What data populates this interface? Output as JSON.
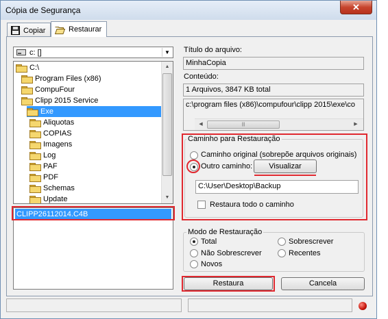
{
  "window": {
    "title": "Cópia de Segurança",
    "close_label": "✕"
  },
  "tabs": [
    {
      "label": "Copiar"
    },
    {
      "label": "Restaurar"
    }
  ],
  "drive": {
    "value": "c: []"
  },
  "tree": {
    "items": [
      {
        "label": "C:\\"
      },
      {
        "label": "Program Files (x86)"
      },
      {
        "label": "CompuFour"
      },
      {
        "label": "Clipp 2015 Service"
      },
      {
        "label": "Exe"
      },
      {
        "label": "Aliquotas"
      },
      {
        "label": "COPIAS"
      },
      {
        "label": "Imagens"
      },
      {
        "label": "Log"
      },
      {
        "label": "PAF"
      },
      {
        "label": "PDF"
      },
      {
        "label": "Schemas"
      },
      {
        "label": "Update"
      }
    ]
  },
  "files": {
    "selected": "CLIPP26112014.C4B"
  },
  "info": {
    "title_label": "Título do arquivo:",
    "title_value": "MinhaCopia",
    "content_label": "Conteúdo:",
    "content_value": "1 Arquivos, 3847 KB total",
    "path_value": "c:\\program files (x86)\\compufour\\clipp 2015\\exe\\co"
  },
  "restore_path": {
    "legend": "Caminho para Restauração",
    "original_option": "Caminho original (sobrepõe arquivos originais)",
    "other_option": "Outro caminho:",
    "view_button": "Visualizar",
    "path_value": "C:\\User\\Desktop\\Backup",
    "restore_all_label": "Restaura todo o caminho"
  },
  "restore_mode": {
    "legend": "Modo de Restauração",
    "options": {
      "total": "Total",
      "overwrite": "Sobrescrever",
      "no_overwrite": "Não Sobrescrever",
      "recent": "Recentes",
      "new": "Novos"
    }
  },
  "actions": {
    "restore": "Restaura",
    "cancel": "Cancela"
  },
  "colors": {
    "highlight": "#e0282f",
    "selection": "#3399ff"
  }
}
